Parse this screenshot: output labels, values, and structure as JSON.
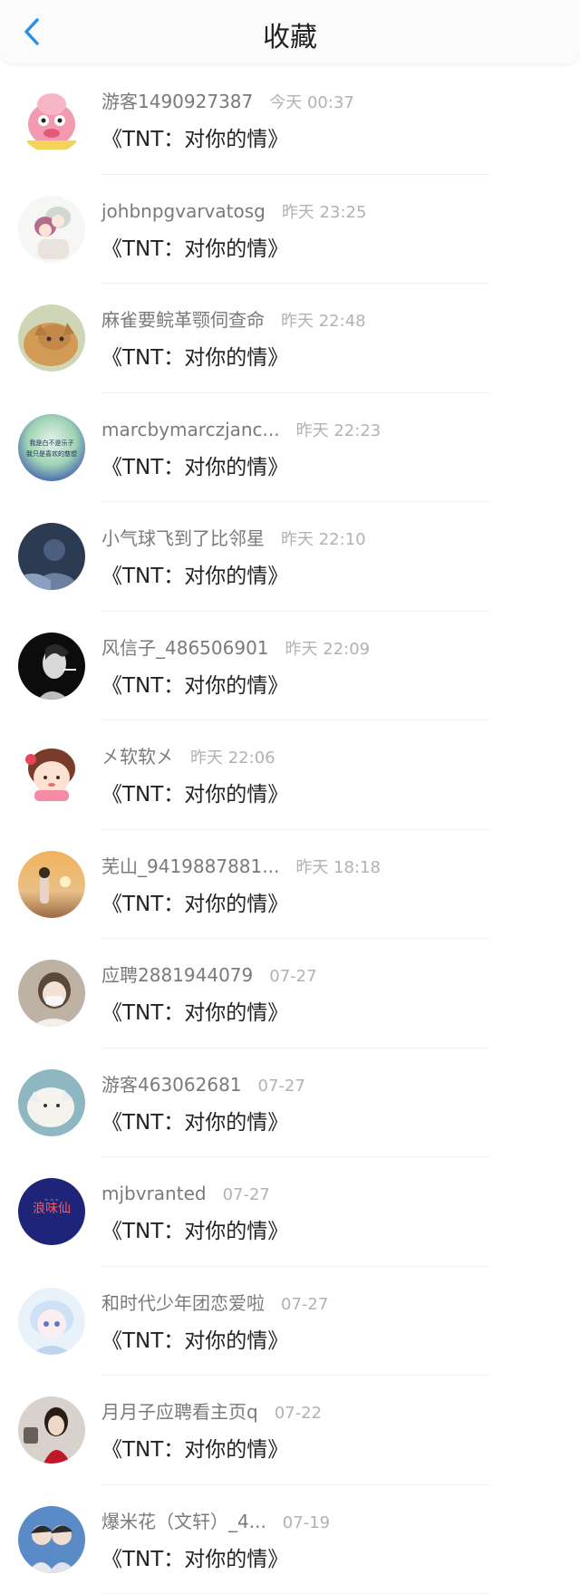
{
  "header": {
    "title": "收藏"
  },
  "items": [
    {
      "name": "游客1490927387",
      "time": "今天 00:37",
      "book": "《TNT：对你的情》",
      "avatar": "pig-mascot"
    },
    {
      "name": "johbnpgvarvatosg",
      "time": "昨天 23:25",
      "book": "《TNT：对你的情》",
      "avatar": "anime-couple"
    },
    {
      "name": "麻雀要鲩革颚伺查命",
      "time": "昨天 22:48",
      "book": "《TNT：对你的情》",
      "avatar": "cat-photo"
    },
    {
      "name": "marcbymarczjanc...",
      "time": "昨天 22:23",
      "book": "《TNT：对你的情》",
      "avatar": "text-gradient"
    },
    {
      "name": "小气球飞到了比邻星",
      "time": "昨天 22:10",
      "book": "《TNT：对你的情》",
      "avatar": "night-portrait"
    },
    {
      "name": "风信子_486506901",
      "time": "昨天 22:09",
      "book": "《TNT：对你的情》",
      "avatar": "smoking-woman"
    },
    {
      "name": "㐅软软㐅",
      "time": "昨天 22:06",
      "book": "《TNT：对你的情》",
      "avatar": "cartoon-girl"
    },
    {
      "name": "芜山_9419887881...",
      "time": "昨天 18:18",
      "book": "《TNT：对你的情》",
      "avatar": "sunset-girl"
    },
    {
      "name": "应聘2881944079",
      "time": "07-27",
      "book": "《TNT：对你的情》",
      "avatar": "masked-girl"
    },
    {
      "name": "游客463062681",
      "time": "07-27",
      "book": "《TNT：对你的情》",
      "avatar": "white-cat"
    },
    {
      "name": "mjbvranted",
      "time": "07-27",
      "book": "《TNT：对你的情》",
      "avatar": "navy-text"
    },
    {
      "name": "和时代少年团恋爱啦",
      "time": "07-27",
      "book": "《TNT：对你的情》",
      "avatar": "anime-blue-girl"
    },
    {
      "name": "月月子应聘看主页q",
      "time": "07-22",
      "book": "《TNT：对你的情》",
      "avatar": "red-dress"
    },
    {
      "name": "爆米花（文轩）_4...",
      "time": "07-19",
      "book": "《TNT：对你的情》",
      "avatar": "two-boys"
    }
  ],
  "avatar_text": {
    "text-gradient": "我是白不是乐子我只是喜欢的慈想",
    "navy-text": "浪味仙"
  },
  "colors": {
    "back_arrow": "#2a8fe8",
    "name": "#7a7a7a",
    "time": "#b2b2b2",
    "book": "#222222"
  }
}
